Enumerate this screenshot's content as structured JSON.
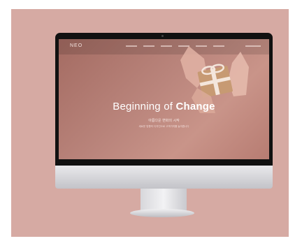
{
  "site": {
    "logo": "NEO",
    "hero": {
      "title_regular": "Beginning of ",
      "title_bold": "Change",
      "subtitle": "아름다운 변화의 시작",
      "tagline": "새로운 방향의 디자인으로 고객가치를 높여줍니다"
    },
    "nav_items": [
      "",
      "",
      "",
      "",
      "",
      ""
    ],
    "image_subject": "gift-box-in-hands"
  },
  "colors": {
    "backdrop": "#d6aaa3",
    "hero_tint": "#b77c72",
    "bezel": "#111111"
  }
}
